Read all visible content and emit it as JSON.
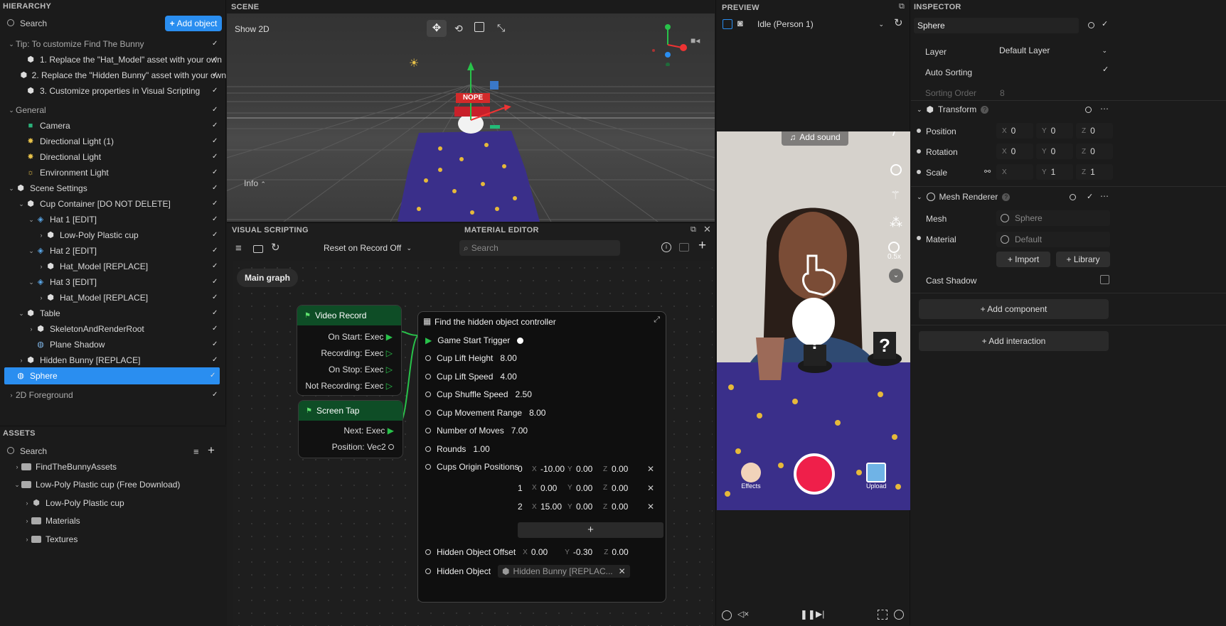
{
  "hierarchy": {
    "title": "HIERARCHY",
    "search_placeholder": "Search",
    "add_button": "Add object",
    "items": [
      {
        "label": "Tip: To customize Find The Bunny",
        "icon": "chevron-down"
      },
      {
        "label": "1. Replace the \"Hat_Model\" asset with your own",
        "icon": "prefab"
      },
      {
        "label": "2. Replace the \"Hidden Bunny\" asset with your own",
        "icon": "prefab"
      },
      {
        "label": "3. Customize properties in Visual Scripting",
        "icon": "prefab"
      },
      {
        "label": "General",
        "icon": "chevron-down"
      },
      {
        "label": "Camera",
        "icon": "camera"
      },
      {
        "label": "Directional Light (1)",
        "icon": "light"
      },
      {
        "label": "Directional Light",
        "icon": "light"
      },
      {
        "label": "Environment Light",
        "icon": "sun"
      },
      {
        "label": "Scene Settings",
        "icon": "prefab"
      },
      {
        "label": "Cup Container [DO NOT DELETE]",
        "icon": "prefab"
      },
      {
        "label": "Hat 1 [EDIT]",
        "icon": "tag"
      },
      {
        "label": "Low-Poly Plastic cup",
        "icon": "prefab"
      },
      {
        "label": "Hat 2 [EDIT]",
        "icon": "tag"
      },
      {
        "label": "Hat_Model [REPLACE]",
        "icon": "prefab"
      },
      {
        "label": "Hat 3 [EDIT]",
        "icon": "tag"
      },
      {
        "label": "Hat_Model [REPLACE]",
        "icon": "prefab"
      },
      {
        "label": "Table",
        "icon": "prefab"
      },
      {
        "label": "SkeletonAndRenderRoot",
        "icon": "prefab"
      },
      {
        "label": "Plane Shadow",
        "icon": "globe"
      },
      {
        "label": "Hidden Bunny [REPLACE]",
        "icon": "prefab"
      },
      {
        "label": "Sphere",
        "icon": "globe"
      },
      {
        "label": "2D Foreground",
        "icon": "chevron-right"
      }
    ]
  },
  "assets": {
    "title": "ASSETS",
    "search_placeholder": "Search",
    "items": [
      "FindTheBunnyAssets",
      "Low-Poly Plastic cup (Free Download)",
      "Low-Poly Plastic cup",
      "Materials",
      "Textures"
    ]
  },
  "scene": {
    "title": "SCENE",
    "show2d": "Show 2D",
    "info": "Info",
    "sign": "NOPE"
  },
  "visual_scripting": {
    "title": "VISUAL SCRIPTING",
    "material_editor": "MATERIAL EDITOR",
    "dropdown": "Reset on Record Off",
    "search_placeholder": "Search",
    "graph_tab": "Main graph",
    "video_record": {
      "title": "Video Record",
      "ports": [
        "On Start: Exec",
        "Recording: Exec",
        "On Stop: Exec",
        "Not Recording: Exec"
      ]
    },
    "screen_tap": {
      "title": "Screen Tap",
      "ports": [
        "Next: Exec",
        "Position: Vec2"
      ]
    },
    "controller": {
      "title": "Find the hidden object controller",
      "trigger": "Game Start Trigger",
      "props": [
        {
          "label": "Cup Lift Height",
          "value": "8.00"
        },
        {
          "label": "Cup Lift Speed",
          "value": "4.00"
        },
        {
          "label": "Cup Shuffle Speed",
          "value": "2.50"
        },
        {
          "label": "Cup Movement Range",
          "value": "8.00"
        },
        {
          "label": "Number of Moves",
          "value": "7.00"
        },
        {
          "label": "Rounds",
          "value": "1.00"
        }
      ],
      "positions_label": "Cups Origin Positions",
      "positions": [
        {
          "i": "0",
          "x": "-10.00",
          "y": "0.00",
          "z": "0.00"
        },
        {
          "i": "1",
          "x": "0.00",
          "y": "0.00",
          "z": "0.00"
        },
        {
          "i": "2",
          "x": "15.00",
          "y": "0.00",
          "z": "0.00"
        }
      ],
      "offset_label": "Hidden Object Offset",
      "offset": {
        "x": "0.00",
        "y": "-0.30",
        "z": "0.00"
      },
      "hidden_label": "Hidden Object",
      "hidden_value": "Hidden Bunny [REPLAC..."
    }
  },
  "preview": {
    "title": "PREVIEW",
    "mode": "Idle (Person 1)",
    "add_sound": "Add sound",
    "speed": "0.5x",
    "effects": "Effects",
    "upload": "Upload"
  },
  "inspector": {
    "title": "INSPECTOR",
    "object": "Sphere",
    "layer_label": "Layer",
    "layer_value": "Default Layer",
    "auto_sorting": "Auto Sorting",
    "sorting_order": "Sorting Order",
    "sorting_value": "8",
    "transform": "Transform",
    "position": {
      "label": "Position",
      "x": "0",
      "y": "0",
      "z": "0"
    },
    "rotation": {
      "label": "Rotation",
      "x": "0",
      "y": "0",
      "z": "0"
    },
    "scale": {
      "label": "Scale",
      "x": "",
      "y": "1",
      "z": "1"
    },
    "mesh_renderer": "Mesh Renderer",
    "mesh_label": "Mesh",
    "mesh_value": "Sphere",
    "material_label": "Material",
    "material_value": "Default",
    "import": "+ Import",
    "library": "+ Library",
    "cast_shadow": "Cast Shadow",
    "add_component": "+ Add component",
    "add_interaction": "+ Add interaction"
  },
  "colors": {
    "accent": "#2a8ef0",
    "node_header": "#0e4d26",
    "record": "#ef1f4a"
  }
}
